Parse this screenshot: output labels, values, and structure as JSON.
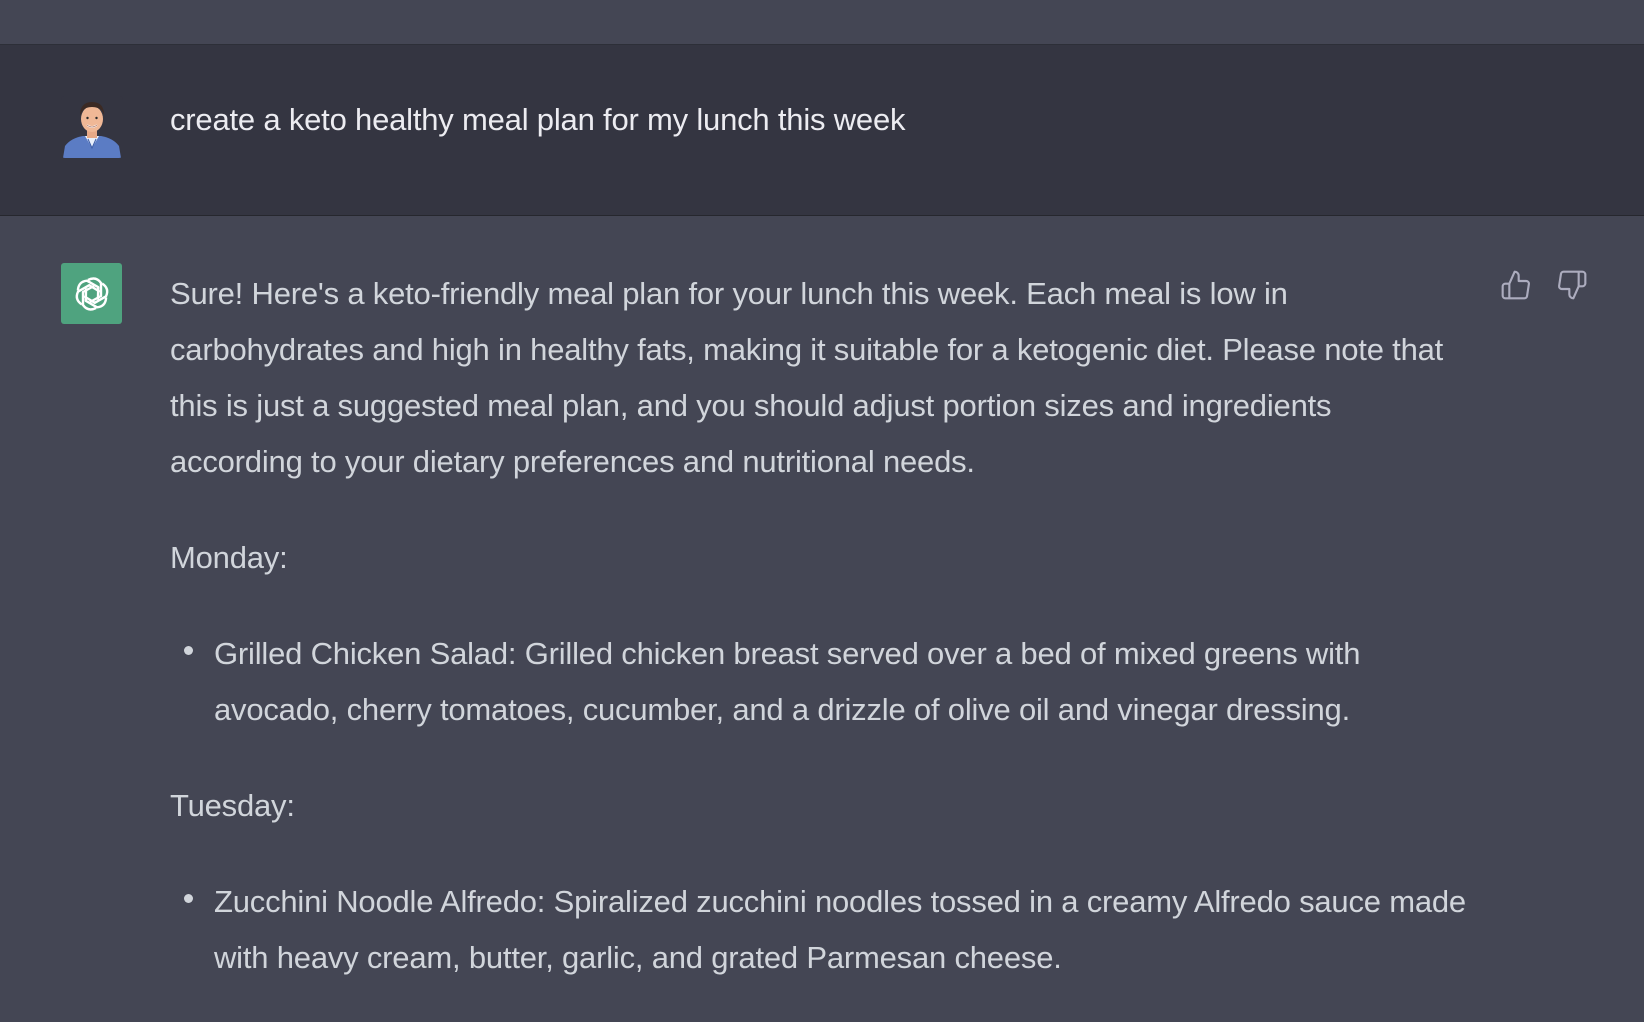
{
  "user_message": {
    "text": "create a keto healthy meal plan for my lunch this week",
    "avatar_icon": "user-avatar-icon"
  },
  "assistant_message": {
    "avatar_icon": "openai-logo-icon",
    "intro": "Sure! Here's a keto-friendly meal plan for your lunch this week. Each meal is low in carbohydrates and high in healthy fats, making it suitable for a ketogenic diet. Please note that this is just a suggested meal plan, and you should adjust portion sizes and ingredients according to your dietary preferences and nutritional needs.",
    "days": [
      {
        "label": "Monday:",
        "items": [
          "Grilled Chicken Salad: Grilled chicken breast served over a bed of mixed greens with avocado, cherry tomatoes, cucumber, and a drizzle of olive oil and vinegar dressing."
        ]
      },
      {
        "label": "Tuesday:",
        "items": [
          "Zucchini Noodle Alfredo: Spiralized zucchini noodles tossed in a creamy Alfredo sauce made with heavy cream, butter, garlic, and grated Parmesan cheese."
        ]
      }
    ]
  },
  "actions": {
    "thumbs_up_icon": "thumbs-up-icon",
    "thumbs_down_icon": "thumbs-down-icon"
  },
  "colors": {
    "user_row_bg": "#343541",
    "assistant_row_bg": "#444654",
    "gpt_avatar_bg": "#4fa37f",
    "text_primary": "#ececf1",
    "text_secondary": "#d1d5db"
  }
}
